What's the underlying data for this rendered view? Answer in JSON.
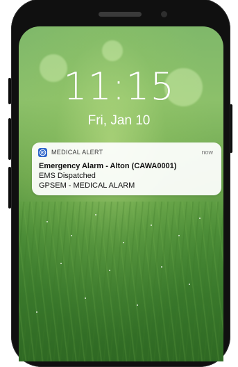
{
  "lock_screen": {
    "time": "11:15",
    "date": "Fri, Jan 10"
  },
  "notification": {
    "app_name": "MEDICAL ALERT",
    "timestamp": "now",
    "app_icon": "medical-alert-app-icon",
    "title": "Emergency Alarm - Alton (CAWA0001)",
    "body_lines": [
      "EMS Dispatched",
      "GPSEM - MEDICAL ALARM"
    ]
  },
  "colors": {
    "phone_frame": "#101010",
    "app_icon_bg": "#2c64c9",
    "notification_bg": "#ffffff",
    "wallpaper_top": "#7fb86a",
    "wallpaper_bottom": "#386f2b"
  }
}
